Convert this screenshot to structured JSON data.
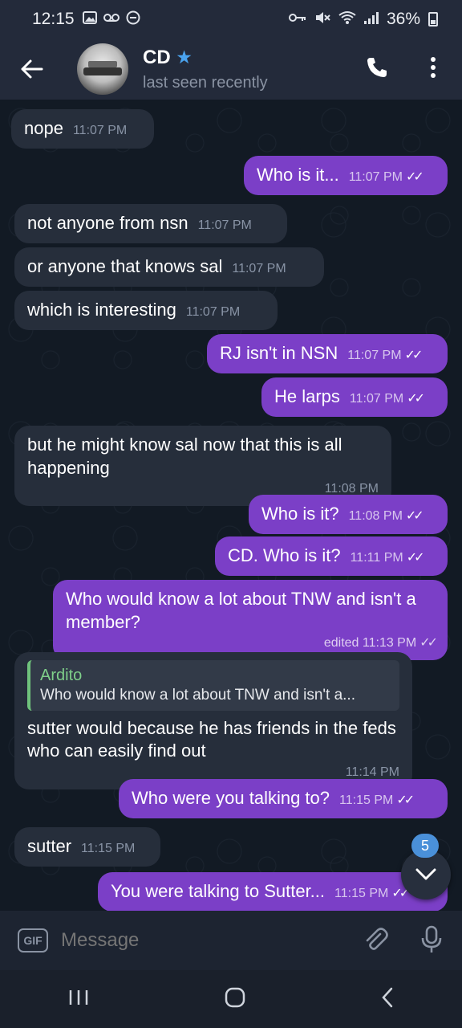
{
  "status_bar": {
    "time": "12:15",
    "battery": "36%"
  },
  "header": {
    "contact_name": "CD",
    "status": "last seen recently"
  },
  "messages": [
    {
      "dir": "in",
      "text": "nope",
      "time": "11:07 PM"
    },
    {
      "dir": "out",
      "text": "Who is it...",
      "time": "11:07 PM"
    },
    {
      "dir": "in",
      "text": "not anyone from nsn",
      "time": "11:07 PM"
    },
    {
      "dir": "in",
      "text": "or anyone that knows sal",
      "time": "11:07 PM"
    },
    {
      "dir": "in",
      "text": "which is interesting",
      "time": "11:07 PM"
    },
    {
      "dir": "out",
      "text": "RJ isn't in NSN",
      "time": "11:07 PM"
    },
    {
      "dir": "out",
      "text": "He larps",
      "time": "11:07 PM"
    },
    {
      "dir": "in",
      "text": "but he might know sal now that this is all happening",
      "time": "11:08 PM"
    },
    {
      "dir": "out",
      "text": "Who is it?",
      "time": "11:08 PM"
    },
    {
      "dir": "out",
      "text": "CD. Who is it?",
      "time": "11:11 PM"
    },
    {
      "dir": "out",
      "text": "Who would know a lot about TNW and isn't a member?",
      "time": "edited 11:13 PM"
    },
    {
      "dir": "in",
      "text": "sutter would because he has friends in the feds who can easily find out",
      "time": "11:14 PM",
      "reply_name": "Ardito",
      "reply_text": "Who would know a lot about TNW and isn't a..."
    },
    {
      "dir": "out",
      "text": "Who were you talking to?",
      "time": "11:15 PM"
    },
    {
      "dir": "in",
      "text": "sutter",
      "time": "11:15 PM"
    },
    {
      "dir": "out",
      "text": "You were talking to Sutter...",
      "time": "11:15 PM"
    }
  ],
  "scroll": {
    "unread_count": "5"
  },
  "composer": {
    "gif_label": "GIF",
    "placeholder": "Message"
  },
  "colors": {
    "outgoing": "#7b3fc7",
    "incoming": "#262e3b",
    "header": "#232a3a",
    "badge": "#4a90d9",
    "reply_accent": "#6fc27c"
  }
}
